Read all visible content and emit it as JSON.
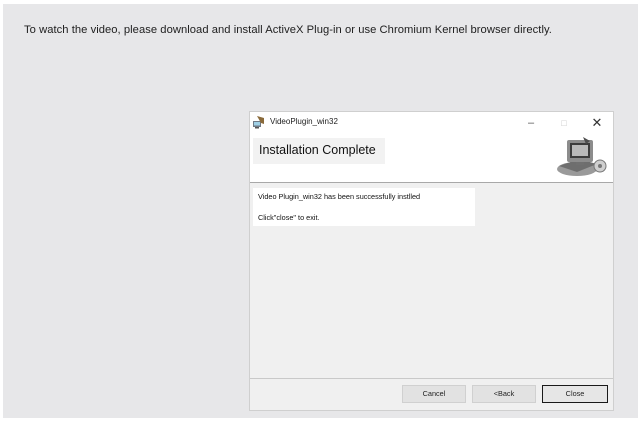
{
  "page": {
    "notice": "To watch the video, please download and install ActiveX Plug-in or use Chromium Kernel browser directly."
  },
  "installer": {
    "window_title": "VideoPlugin_win32",
    "controls": {
      "minimize": "–",
      "maximize": "□",
      "close": "✕"
    },
    "header_title": "Installation Complete",
    "message_line1": "Video Plugin_win32 has been successfully instlled",
    "message_line2": "Click\"close\" to exit.",
    "buttons": {
      "cancel": "Cancel",
      "back": "<Back",
      "close": "Close"
    }
  },
  "icons": {
    "app": "installer-app-icon",
    "header": "computer-setup-icon"
  }
}
